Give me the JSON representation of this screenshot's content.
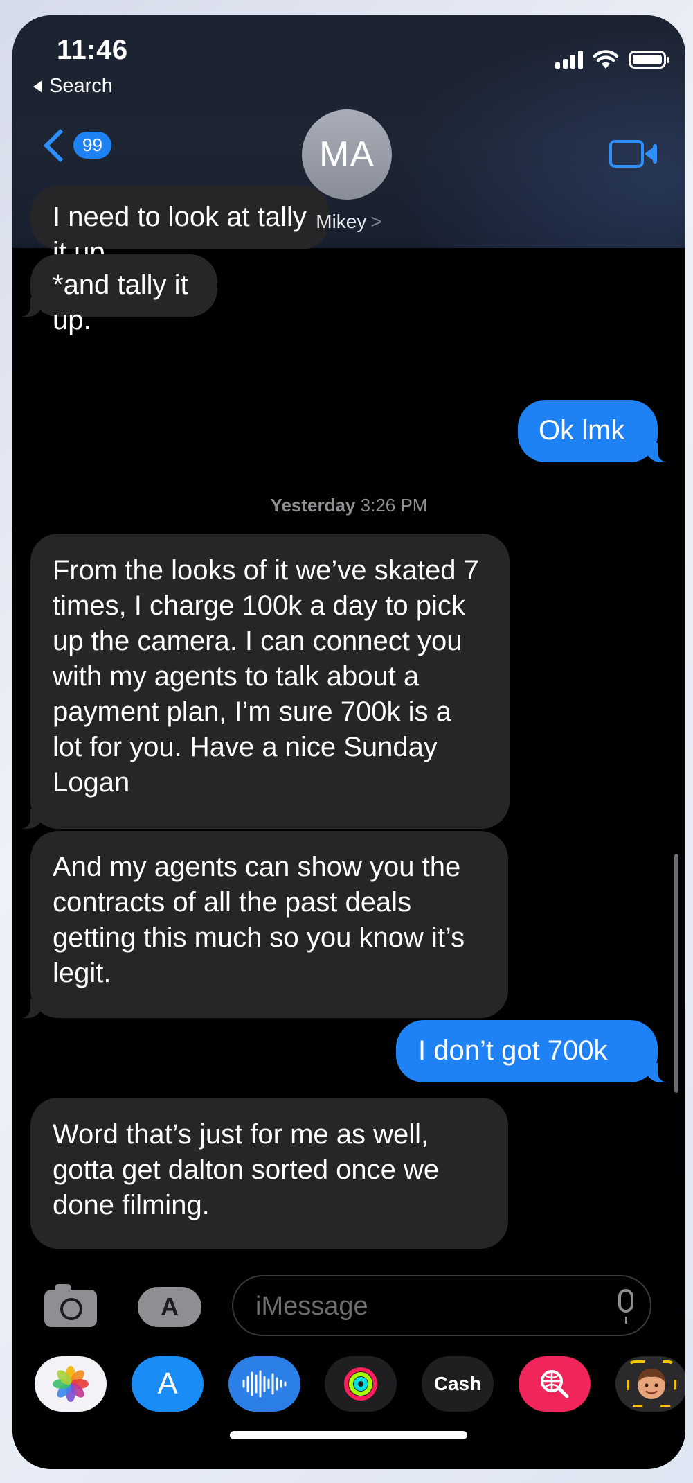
{
  "status_bar": {
    "time": "11:46",
    "back_app": "Search"
  },
  "header": {
    "back_count": "99",
    "avatar_initials": "MA",
    "contact_name": "Mikey",
    "contact_chevron": ">"
  },
  "messages": [
    {
      "direction": "incoming",
      "text": "I need to look at tally it up."
    },
    {
      "direction": "incoming",
      "text": "*and tally it up."
    },
    {
      "direction": "outgoing",
      "text": "Ok lmk"
    },
    {
      "direction": "incoming",
      "text": "From the looks of it we’ve skated 7 times, I charge 100k a day to pick up the camera. I can connect you with my agents to talk about a payment plan, I’m sure 700k is a lot for you. Have a nice Sunday Logan"
    },
    {
      "direction": "incoming",
      "text": "And my agents can show you the contracts of all the past deals getting this much so you know it’s legit."
    },
    {
      "direction": "outgoing",
      "text": "I don’t got 700k"
    },
    {
      "direction": "incoming",
      "text": "Word that’s just for me as well, gotta get dalton sorted once we done filming."
    }
  ],
  "timestamp": {
    "day": "Yesterday",
    "time": "3:26 PM"
  },
  "compose": {
    "placeholder": "iMessage",
    "apps_label": "A"
  },
  "app_drawer": [
    {
      "name": "Photos",
      "icon": "photos-icon"
    },
    {
      "name": "App Store",
      "icon": "app-store-icon",
      "glyph": "A"
    },
    {
      "name": "Audio Message",
      "icon": "audio-waveform-icon"
    },
    {
      "name": "Fitness",
      "icon": "activity-rings-icon"
    },
    {
      "name": "Apple Cash",
      "icon": "apple-cash-icon",
      "label": "Cash"
    },
    {
      "name": "Images",
      "icon": "image-search-icon"
    },
    {
      "name": "Memoji",
      "icon": "memoji-icon"
    }
  ],
  "colors": {
    "accent": "#1e82f5",
    "incoming_bubble": "#262628",
    "background": "#000000"
  }
}
